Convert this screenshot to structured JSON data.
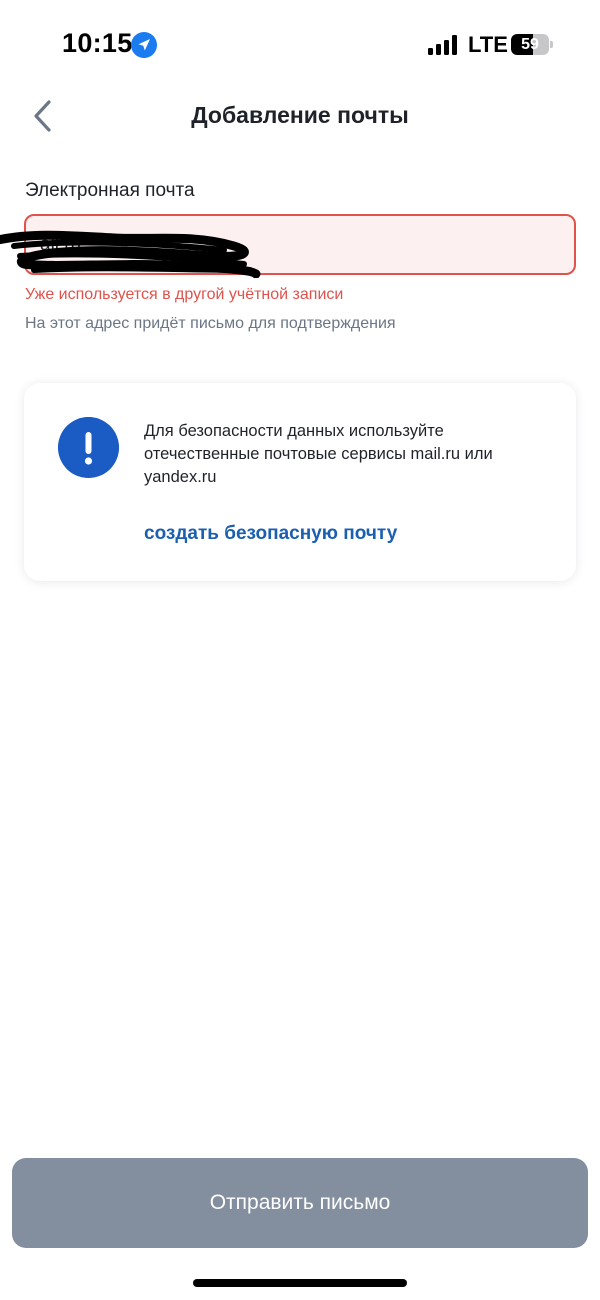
{
  "status_bar": {
    "time": "10:15",
    "network": "LTE",
    "battery_level": "59",
    "battery_fraction": 0.59
  },
  "header": {
    "title": "Добавление почты",
    "back_icon": "chevron-left-icon"
  },
  "email_field": {
    "label": "Электронная почта",
    "value": "ail.ru",
    "error": "Уже используется в другой учётной записи",
    "hint": "На этот адрес придёт письмо для подтверждения"
  },
  "info_card": {
    "icon": "exclamation-icon",
    "text": "Для безопасности данных используйте отечественные почтовые сервисы mail.ru или yandex.ru",
    "link_label": "создать безопасную почту"
  },
  "footer": {
    "send_label": "Отправить письмо"
  },
  "colors": {
    "error": "#e0524c",
    "error_bg": "#fdf0f0",
    "accent": "#1b5cc4",
    "link": "#1b5fb0",
    "button_disabled": "#838e9f",
    "hint": "#6b7686"
  }
}
